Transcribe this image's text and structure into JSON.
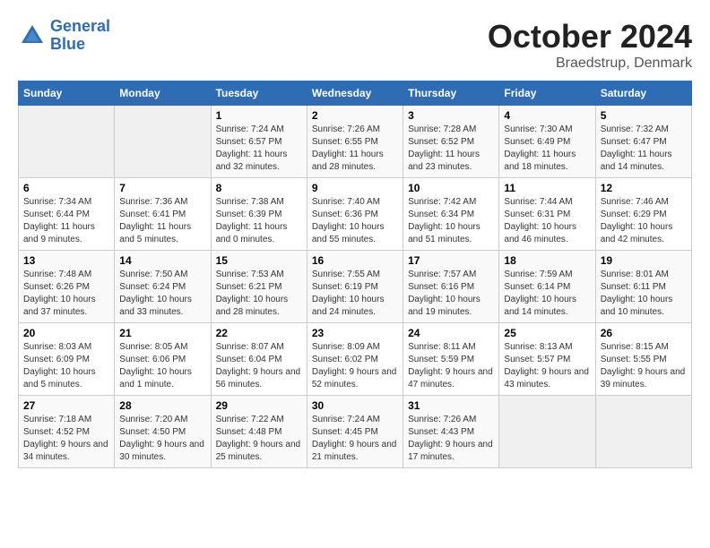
{
  "header": {
    "logo_line1": "General",
    "logo_line2": "Blue",
    "month_title": "October 2024",
    "location": "Braedstrup, Denmark"
  },
  "days_of_week": [
    "Sunday",
    "Monday",
    "Tuesday",
    "Wednesday",
    "Thursday",
    "Friday",
    "Saturday"
  ],
  "weeks": [
    [
      {
        "day": "",
        "empty": true
      },
      {
        "day": "",
        "empty": true
      },
      {
        "day": "1",
        "sunrise": "Sunrise: 7:24 AM",
        "sunset": "Sunset: 6:57 PM",
        "daylight": "Daylight: 11 hours and 32 minutes."
      },
      {
        "day": "2",
        "sunrise": "Sunrise: 7:26 AM",
        "sunset": "Sunset: 6:55 PM",
        "daylight": "Daylight: 11 hours and 28 minutes."
      },
      {
        "day": "3",
        "sunrise": "Sunrise: 7:28 AM",
        "sunset": "Sunset: 6:52 PM",
        "daylight": "Daylight: 11 hours and 23 minutes."
      },
      {
        "day": "4",
        "sunrise": "Sunrise: 7:30 AM",
        "sunset": "Sunset: 6:49 PM",
        "daylight": "Daylight: 11 hours and 18 minutes."
      },
      {
        "day": "5",
        "sunrise": "Sunrise: 7:32 AM",
        "sunset": "Sunset: 6:47 PM",
        "daylight": "Daylight: 11 hours and 14 minutes."
      }
    ],
    [
      {
        "day": "6",
        "sunrise": "Sunrise: 7:34 AM",
        "sunset": "Sunset: 6:44 PM",
        "daylight": "Daylight: 11 hours and 9 minutes."
      },
      {
        "day": "7",
        "sunrise": "Sunrise: 7:36 AM",
        "sunset": "Sunset: 6:41 PM",
        "daylight": "Daylight: 11 hours and 5 minutes."
      },
      {
        "day": "8",
        "sunrise": "Sunrise: 7:38 AM",
        "sunset": "Sunset: 6:39 PM",
        "daylight": "Daylight: 11 hours and 0 minutes."
      },
      {
        "day": "9",
        "sunrise": "Sunrise: 7:40 AM",
        "sunset": "Sunset: 6:36 PM",
        "daylight": "Daylight: 10 hours and 55 minutes."
      },
      {
        "day": "10",
        "sunrise": "Sunrise: 7:42 AM",
        "sunset": "Sunset: 6:34 PM",
        "daylight": "Daylight: 10 hours and 51 minutes."
      },
      {
        "day": "11",
        "sunrise": "Sunrise: 7:44 AM",
        "sunset": "Sunset: 6:31 PM",
        "daylight": "Daylight: 10 hours and 46 minutes."
      },
      {
        "day": "12",
        "sunrise": "Sunrise: 7:46 AM",
        "sunset": "Sunset: 6:29 PM",
        "daylight": "Daylight: 10 hours and 42 minutes."
      }
    ],
    [
      {
        "day": "13",
        "sunrise": "Sunrise: 7:48 AM",
        "sunset": "Sunset: 6:26 PM",
        "daylight": "Daylight: 10 hours and 37 minutes."
      },
      {
        "day": "14",
        "sunrise": "Sunrise: 7:50 AM",
        "sunset": "Sunset: 6:24 PM",
        "daylight": "Daylight: 10 hours and 33 minutes."
      },
      {
        "day": "15",
        "sunrise": "Sunrise: 7:53 AM",
        "sunset": "Sunset: 6:21 PM",
        "daylight": "Daylight: 10 hours and 28 minutes."
      },
      {
        "day": "16",
        "sunrise": "Sunrise: 7:55 AM",
        "sunset": "Sunset: 6:19 PM",
        "daylight": "Daylight: 10 hours and 24 minutes."
      },
      {
        "day": "17",
        "sunrise": "Sunrise: 7:57 AM",
        "sunset": "Sunset: 6:16 PM",
        "daylight": "Daylight: 10 hours and 19 minutes."
      },
      {
        "day": "18",
        "sunrise": "Sunrise: 7:59 AM",
        "sunset": "Sunset: 6:14 PM",
        "daylight": "Daylight: 10 hours and 14 minutes."
      },
      {
        "day": "19",
        "sunrise": "Sunrise: 8:01 AM",
        "sunset": "Sunset: 6:11 PM",
        "daylight": "Daylight: 10 hours and 10 minutes."
      }
    ],
    [
      {
        "day": "20",
        "sunrise": "Sunrise: 8:03 AM",
        "sunset": "Sunset: 6:09 PM",
        "daylight": "Daylight: 10 hours and 5 minutes."
      },
      {
        "day": "21",
        "sunrise": "Sunrise: 8:05 AM",
        "sunset": "Sunset: 6:06 PM",
        "daylight": "Daylight: 10 hours and 1 minute."
      },
      {
        "day": "22",
        "sunrise": "Sunrise: 8:07 AM",
        "sunset": "Sunset: 6:04 PM",
        "daylight": "Daylight: 9 hours and 56 minutes."
      },
      {
        "day": "23",
        "sunrise": "Sunrise: 8:09 AM",
        "sunset": "Sunset: 6:02 PM",
        "daylight": "Daylight: 9 hours and 52 minutes."
      },
      {
        "day": "24",
        "sunrise": "Sunrise: 8:11 AM",
        "sunset": "Sunset: 5:59 PM",
        "daylight": "Daylight: 9 hours and 47 minutes."
      },
      {
        "day": "25",
        "sunrise": "Sunrise: 8:13 AM",
        "sunset": "Sunset: 5:57 PM",
        "daylight": "Daylight: 9 hours and 43 minutes."
      },
      {
        "day": "26",
        "sunrise": "Sunrise: 8:15 AM",
        "sunset": "Sunset: 5:55 PM",
        "daylight": "Daylight: 9 hours and 39 minutes."
      }
    ],
    [
      {
        "day": "27",
        "sunrise": "Sunrise: 7:18 AM",
        "sunset": "Sunset: 4:52 PM",
        "daylight": "Daylight: 9 hours and 34 minutes."
      },
      {
        "day": "28",
        "sunrise": "Sunrise: 7:20 AM",
        "sunset": "Sunset: 4:50 PM",
        "daylight": "Daylight: 9 hours and 30 minutes."
      },
      {
        "day": "29",
        "sunrise": "Sunrise: 7:22 AM",
        "sunset": "Sunset: 4:48 PM",
        "daylight": "Daylight: 9 hours and 25 minutes."
      },
      {
        "day": "30",
        "sunrise": "Sunrise: 7:24 AM",
        "sunset": "Sunset: 4:45 PM",
        "daylight": "Daylight: 9 hours and 21 minutes."
      },
      {
        "day": "31",
        "sunrise": "Sunrise: 7:26 AM",
        "sunset": "Sunset: 4:43 PM",
        "daylight": "Daylight: 9 hours and 17 minutes."
      },
      {
        "day": "",
        "empty": true
      },
      {
        "day": "",
        "empty": true
      }
    ]
  ]
}
